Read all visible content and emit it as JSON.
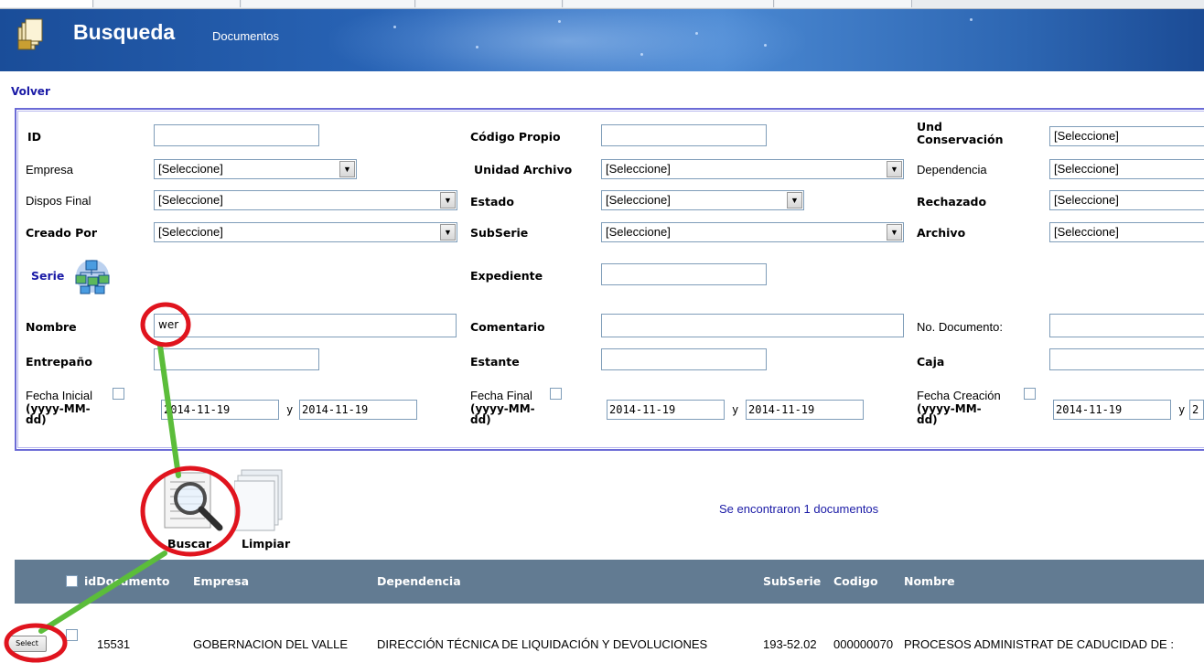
{
  "header": {
    "title": "Busqueda",
    "subtitle": "Documentos"
  },
  "nav": {
    "back_link": "Volver"
  },
  "form": {
    "id_label": "ID",
    "id_value": "",
    "codigo_propio_label": "Código Propio",
    "und_conservacion_label_line1": "Und",
    "und_conservacion_label_line2": "Conservación",
    "empresa_label": "Empresa",
    "unidad_archivo_label": "Unidad Archivo",
    "dependencia_label": "Dependencia",
    "dispos_final_label": "Dispos Final",
    "estado_label": "Estado",
    "rechazado_label": "Rechazado",
    "creado_por_label": "Creado Por",
    "subserie_label": "SubSerie",
    "archivo_label": "Archivo",
    "serie_label": "Serie",
    "expediente_label": "Expediente",
    "nombre_label": "Nombre",
    "nombre_value": "wer",
    "comentario_label": "Comentario",
    "no_documento_label": "No. Documento:",
    "entrepano_label": "Entrepaño",
    "estante_label": "Estante",
    "caja_label": "Caja",
    "fecha_inicial_label": "Fecha Inicial",
    "fecha_final_label": "Fecha Final",
    "fecha_creacion_label": "Fecha Creación",
    "date_format_line1": "(yyyy-MM-",
    "date_format_line2": "dd)",
    "select_placeholder": "[Seleccione]",
    "date_from": "2014-11-19",
    "date_to": "2014-11-19",
    "date_to_partial": "2",
    "y_sep": "y"
  },
  "actions": {
    "search_label": "Buscar",
    "clear_label": "Limpiar"
  },
  "results": {
    "count_text": "Se encontraron 1 documentos"
  },
  "table": {
    "columns": [
      "idDocumento",
      "Empresa",
      "Dependencia",
      "SubSerie",
      "Codigo",
      "Nombre"
    ],
    "rows": [
      {
        "select_label": "Select",
        "idDocumento": "15531",
        "empresa": "GOBERNACION DEL VALLE",
        "dependencia": "DIRECCIÓN TÉCNICA DE LIQUIDACIÓN Y DEVOLUCIONES",
        "subserie": "193-52.02",
        "codigo": "000000070",
        "nombre": "PROCESOS ADMINISTRAT DE CADUCIDAD DE :"
      }
    ]
  },
  "annotations": {
    "circle_color": "#e0141e",
    "line_color": "#5bbd3a"
  },
  "colors": {
    "header_blue": "#1f56a8",
    "grid_header": "#627b92",
    "panel_border": "#6b6bd6",
    "link_blue": "#1a1aa6"
  }
}
